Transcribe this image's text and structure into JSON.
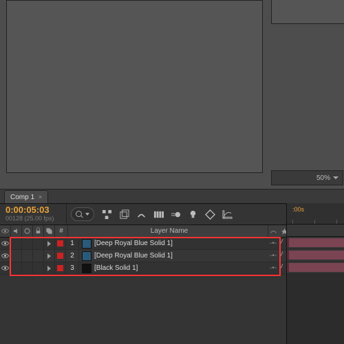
{
  "viewer": {
    "zoom": "50%"
  },
  "panel": {
    "tab": "Comp 1",
    "timecode": "0:00:05:03",
    "frameinfo": "00128 (25.00 fps)",
    "time_marker": ":00s"
  },
  "columns": {
    "number": "#",
    "layer_name": "Layer Name"
  },
  "layers": [
    {
      "num": "1",
      "color": "#2a5a7a",
      "name": "[Deep Royal Blue Solid 1]",
      "label": "#c22",
      "fx": false
    },
    {
      "num": "2",
      "color": "#2a5a7a",
      "name": "[Deep Royal Blue Solid 1]",
      "label": "#c22",
      "fx": false
    },
    {
      "num": "3",
      "color": "#111",
      "name": "[Black Solid 1]",
      "label": "#c22",
      "fx": true
    }
  ]
}
